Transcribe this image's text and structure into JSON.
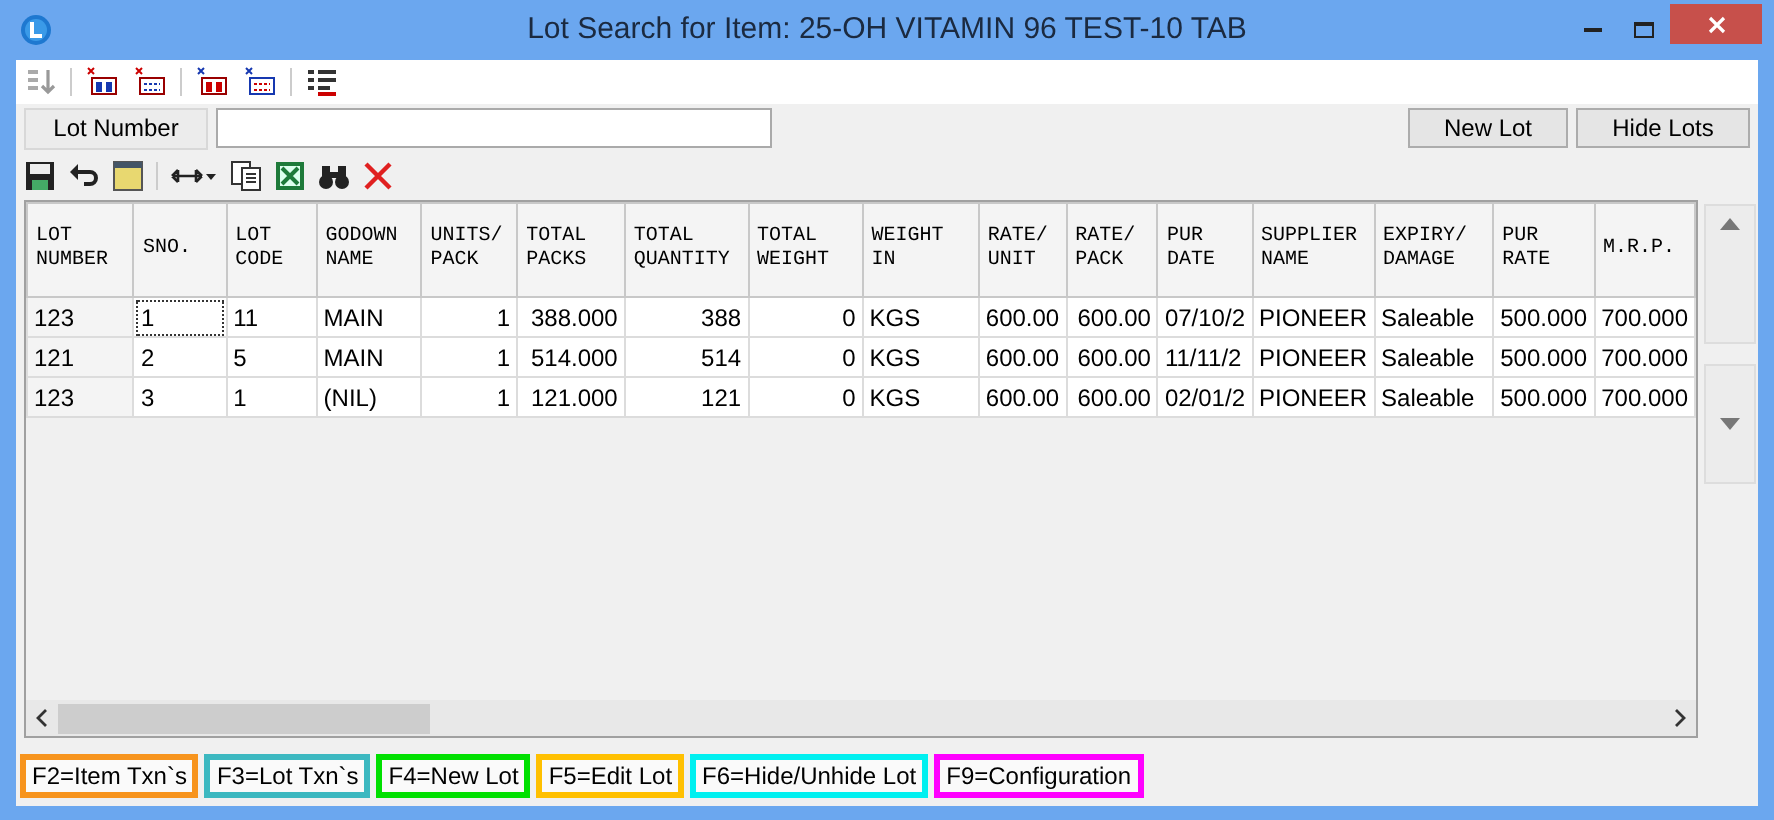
{
  "window": {
    "title": "Lot Search for Item: 25-OH VITAMIN 96 TEST-10 TAB"
  },
  "search": {
    "label": "Lot Number"
  },
  "buttons": [
    "New Lot",
    "Hide Lots"
  ],
  "table": {
    "columns": [
      "LOT NUMBER",
      "SNO.",
      "LOT CODE",
      "GODOWN NAME",
      "UNITS/ PACK",
      "TOTAL PACKS",
      "TOTAL QUANTITY",
      "TOTAL WEIGHT",
      "WEIGHT IN",
      "RATE/ UNIT",
      "RATE/ PACK",
      "PUR DATE",
      "SUPPLIER NAME",
      "EXPIRY/ DAMAGE",
      "PUR RATE",
      "M.R.P."
    ],
    "rows": [
      {
        "focused": true,
        "cells": [
          "123",
          "1",
          "11",
          "MAIN",
          "1",
          "388.000",
          "388",
          "0",
          "KGS",
          "600.00",
          "600.00",
          "07/10/2",
          "PIONEER",
          "Saleable",
          "500.000",
          "700.000"
        ]
      },
      {
        "focused": false,
        "cells": [
          "121",
          "2",
          "5",
          "MAIN",
          "1",
          "514.000",
          "514",
          "0",
          "KGS",
          "600.00",
          "600.00",
          "11/11/2",
          "PIONEER",
          "Saleable",
          "500.000",
          "700.000"
        ]
      },
      {
        "focused": false,
        "cells": [
          "123",
          "3",
          "1",
          "(NIL)",
          "1",
          "121.000",
          "121",
          "0",
          "KGS",
          "600.00",
          "600.00",
          "02/01/2",
          "PIONEER",
          "Saleable",
          "500.000",
          "700.000"
        ]
      }
    ]
  },
  "shortcuts": [
    {
      "label": "F2=Item Txn`s",
      "color": "#f7941d"
    },
    {
      "label": "F3=Lot Txn`s",
      "color": "#3cb8c0"
    },
    {
      "label": "F4=New Lot",
      "color": "#00e000"
    },
    {
      "label": "F5=Edit Lot",
      "color": "#ffc000"
    },
    {
      "label": "F6=Hide/Unhide Lot",
      "color": "#00f0f0"
    },
    {
      "label": "F9=Configuration",
      "color": "#ff00ff"
    }
  ]
}
